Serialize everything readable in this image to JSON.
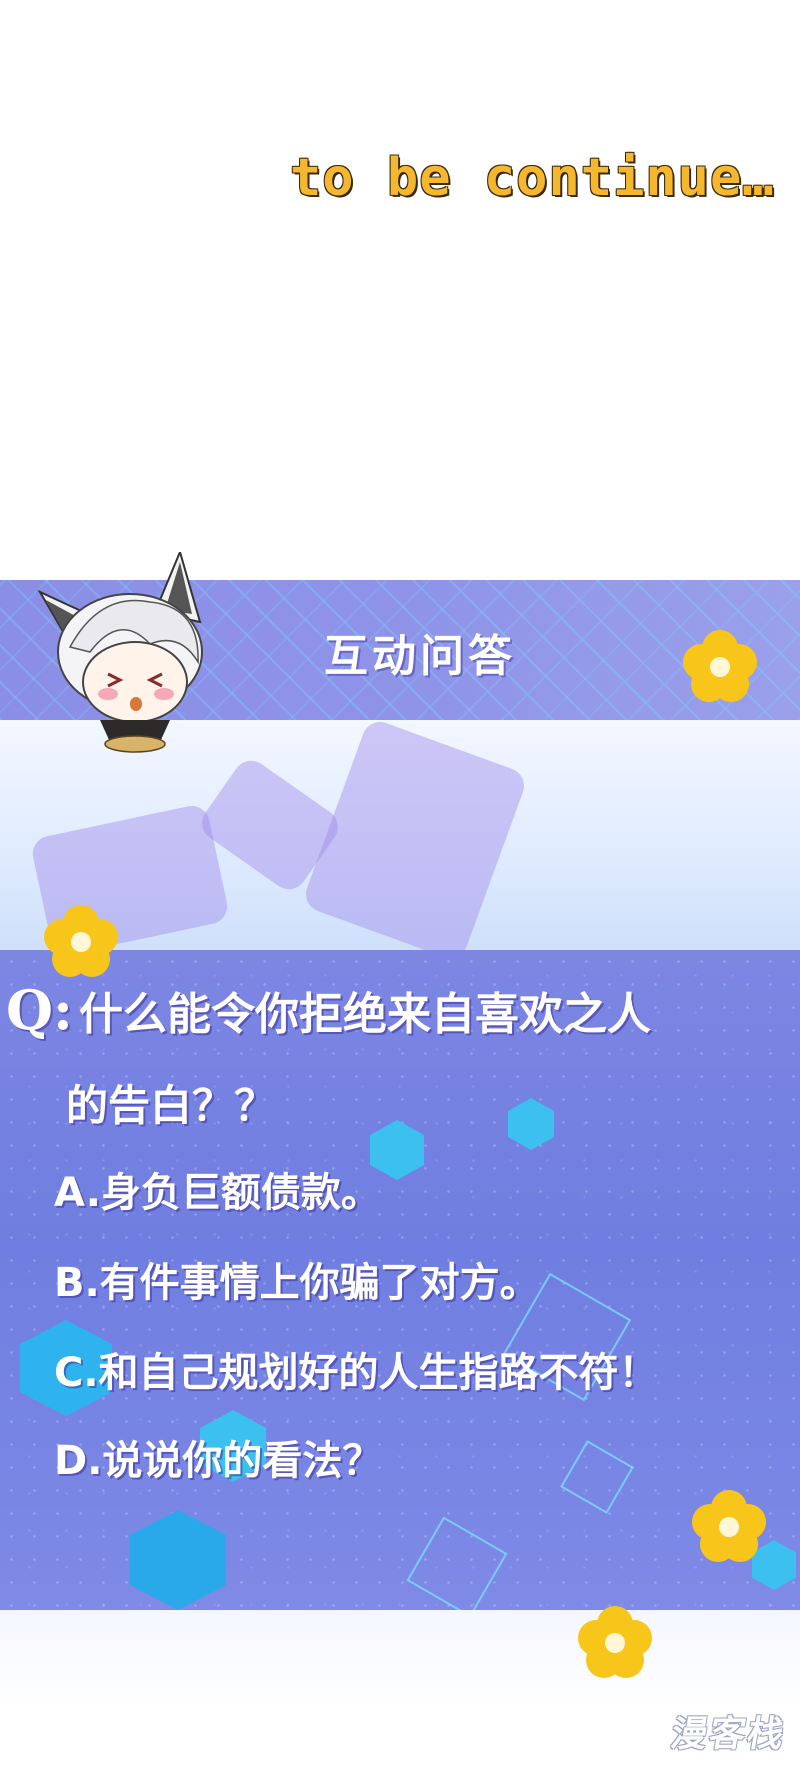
{
  "ending_caption": "to be continue…",
  "section": {
    "title": "互动问答"
  },
  "question": {
    "label": "Q:",
    "line1": "什么能令你拒绝来自喜欢之人",
    "line2": "的告白？？"
  },
  "options": {
    "a": "A.身负巨额债款。",
    "b": "B.有件事情上你骗了对方。",
    "c": "C.和自己规划好的人生指路不符！",
    "d": "D.说说你的看法？"
  },
  "watermark": "漫客栈",
  "colors": {
    "caption": "#f5b72e",
    "band": "#8b8ee6",
    "panel": "#6f7ee0",
    "flower": "#f8c61a",
    "hex": "#3bc0f0"
  },
  "icons": [
    "fox-boy-chibi",
    "flower-icon",
    "hexagon-decoration",
    "cube-outline-decoration"
  ]
}
